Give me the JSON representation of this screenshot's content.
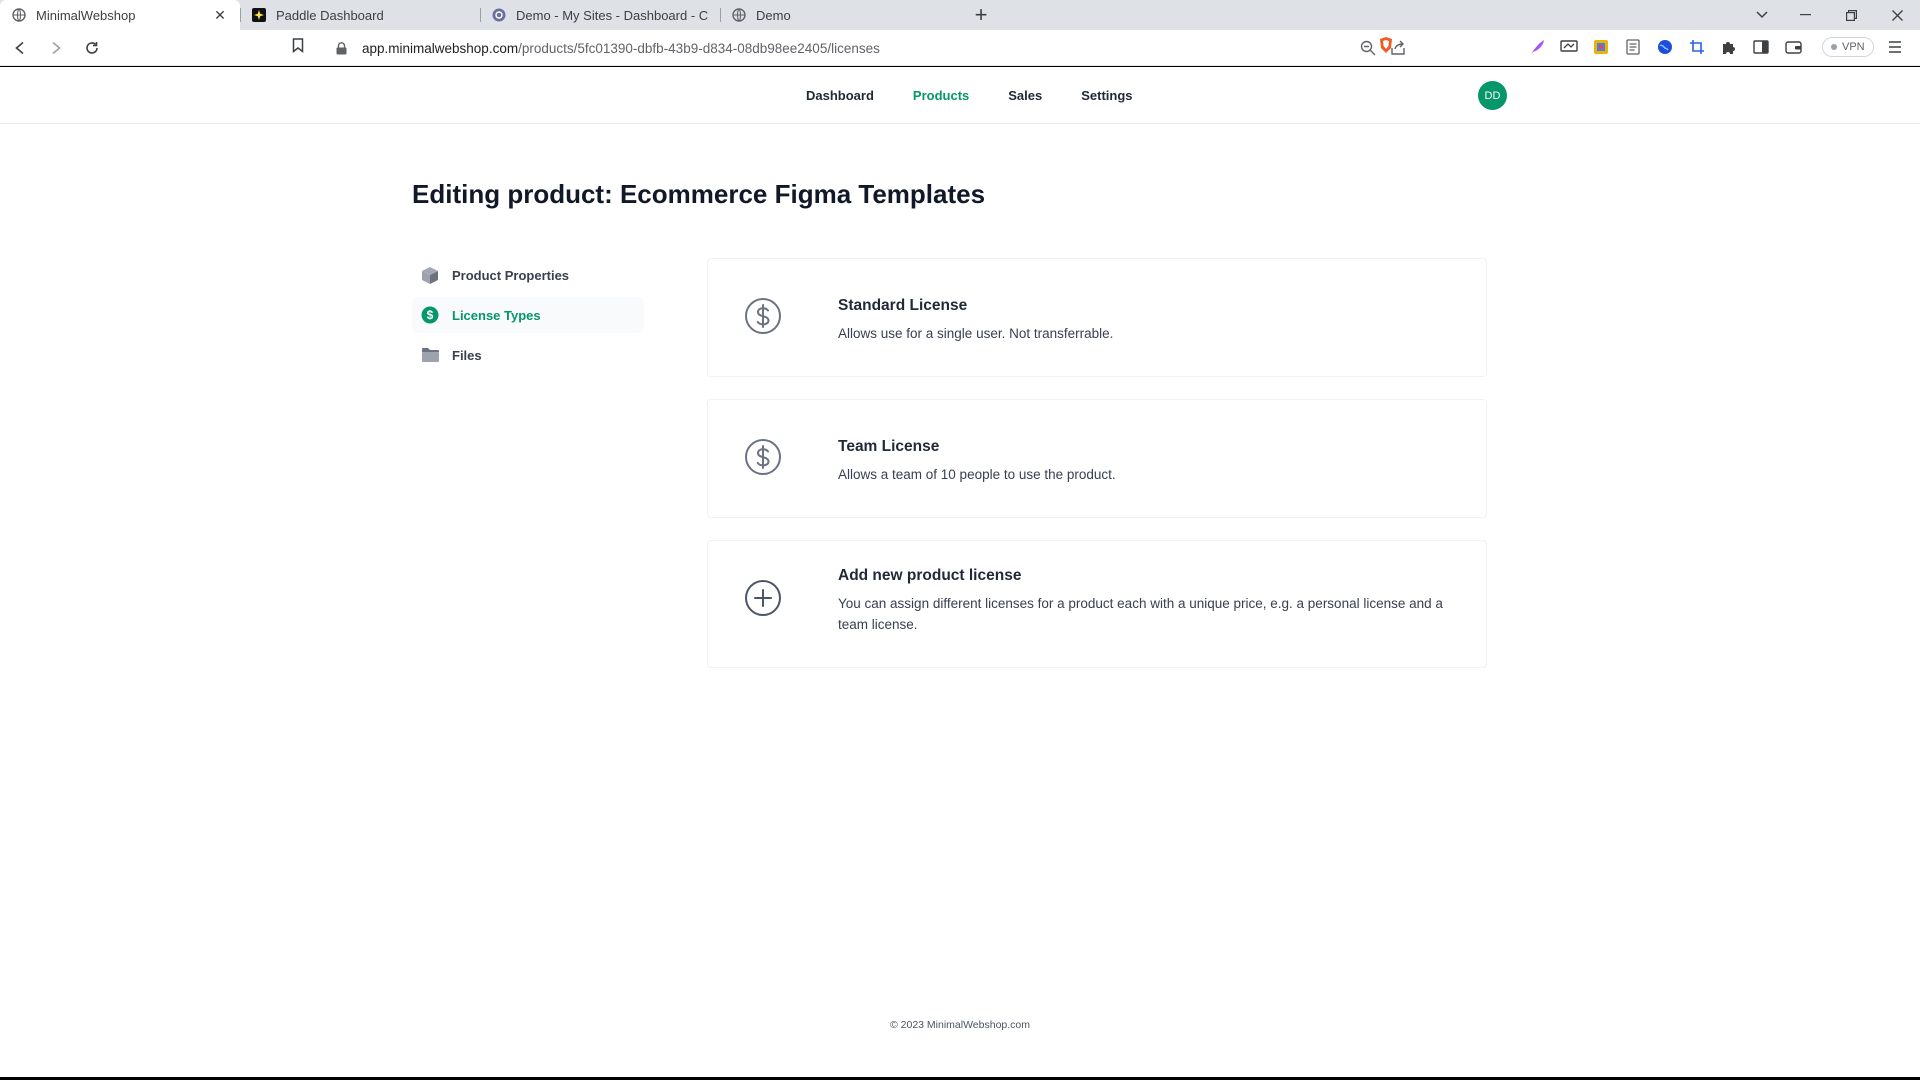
{
  "browser": {
    "tabs": [
      {
        "title": "MinimalWebshop",
        "active": true,
        "favicon": "globe-icon"
      },
      {
        "title": "Paddle Dashboard",
        "active": false,
        "favicon": "paddle-icon"
      },
      {
        "title": "Demo - My Sites - Dashboard - Carrd",
        "active": false,
        "favicon": "carrd-icon"
      },
      {
        "title": "Demo",
        "active": false,
        "favicon": "globe-icon"
      }
    ],
    "new_tab_label": "+",
    "url_host": "app.minimalwebshop.com",
    "url_path": "/products/5fc01390-dbfb-43b9-d834-08db98ee2405/licenses",
    "vpn_label": "VPN"
  },
  "nav": {
    "items": [
      {
        "label": "Dashboard",
        "active": false
      },
      {
        "label": "Products",
        "active": true
      },
      {
        "label": "Sales",
        "active": false
      },
      {
        "label": "Settings",
        "active": false
      }
    ],
    "avatar_initials": "DD",
    "accent_color": "#059669"
  },
  "page": {
    "title": "Editing product: Ecommerce Figma Templates"
  },
  "sidebar": {
    "items": [
      {
        "label": "Product Properties",
        "icon": "cube-icon",
        "active": false
      },
      {
        "label": "License Types",
        "icon": "dollar-circle-icon",
        "active": true
      },
      {
        "label": "Files",
        "icon": "folder-icon",
        "active": false
      }
    ]
  },
  "licenses": [
    {
      "name": "Standard License",
      "description": "Allows use for a single user. Not transferrable.",
      "icon": "dollar-circle-icon"
    },
    {
      "name": "Team License",
      "description": "Allows a team of 10 people to use the product.",
      "icon": "dollar-circle-icon"
    }
  ],
  "add_license": {
    "title": "Add new product license",
    "description": "You can assign different licenses for a product each with a unique price, e.g. a personal license and a team license.",
    "icon": "plus-circle-icon"
  },
  "footer": {
    "text": "© 2023 MinimalWebshop.com"
  }
}
